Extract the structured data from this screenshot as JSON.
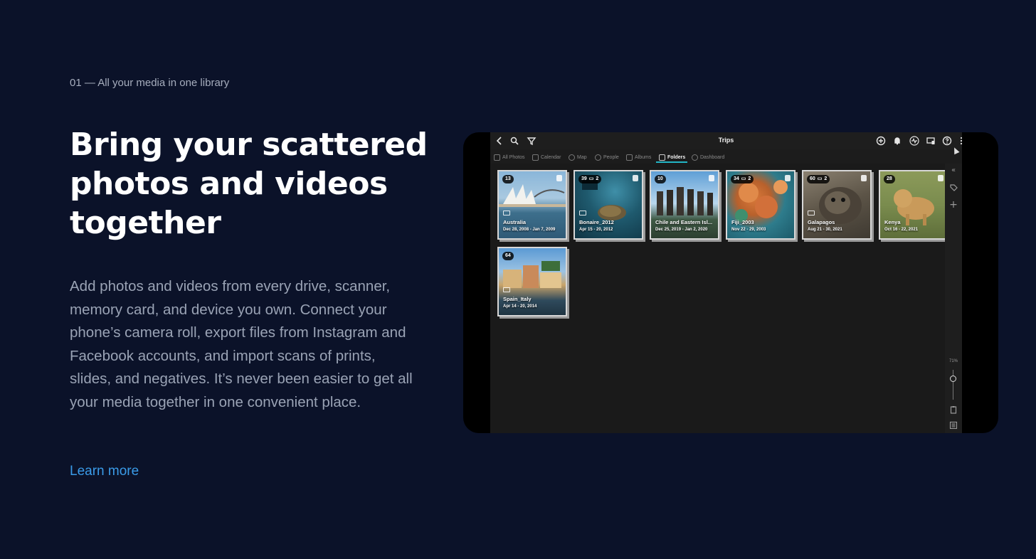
{
  "section": {
    "eyebrow": "01 — All your media in one library",
    "headline": "Bring your scattered photos and videos together",
    "body": "Add photos and videos from every drive, scanner, memory card, and device you own. Connect your phone’s camera roll, export files from Instagram and Facebook accounts, and import scans of prints, slides, and negatives. It’s never been easier to get all your media together in one convenient place.",
    "learn_more": "Learn more"
  },
  "app": {
    "title": "Trips",
    "toolbar_icons": [
      "back-icon",
      "search-icon",
      "filter-icon",
      "add-icon",
      "bell-icon",
      "activity-icon",
      "devices-icon",
      "help-icon",
      "more-icon"
    ],
    "tabs": [
      {
        "label": "All Photos",
        "icon": "grid-icon",
        "active": false
      },
      {
        "label": "Calendar",
        "icon": "calendar-icon",
        "active": false
      },
      {
        "label": "Map",
        "icon": "map-pin-icon",
        "active": false
      },
      {
        "label": "People",
        "icon": "people-icon",
        "active": false
      },
      {
        "label": "Albums",
        "icon": "album-icon",
        "active": false
      },
      {
        "label": "Folders",
        "icon": "folder-icon",
        "active": true
      },
      {
        "label": "Dashboard",
        "icon": "dashboard-icon",
        "active": false
      }
    ],
    "zoom_level": "71%",
    "zoom_fraction": 0.71,
    "colors": {
      "accent": "#22b5c6",
      "link": "#3a9be8",
      "background": "#0b1229"
    },
    "folders": [
      {
        "name": "Australia",
        "dates": "Dec 28, 2008 - Jan 7, 2009",
        "count": "13",
        "subfolders": ""
      },
      {
        "name": "Bonaire_2012",
        "dates": "Apr 15 - 20, 2012",
        "count": "39",
        "subfolders": "2"
      },
      {
        "name": "Chile and Eastern Isl...",
        "dates": "Dec 25, 2019 - Jan 2, 2020",
        "count": "10",
        "subfolders": ""
      },
      {
        "name": "Fiji_2003",
        "dates": "Nov 22 - 29, 2003",
        "count": "34",
        "subfolders": "2"
      },
      {
        "name": "Galapagos",
        "dates": "Aug 21 - 30, 2021",
        "count": "60",
        "subfolders": "2"
      },
      {
        "name": "Kenya",
        "dates": "Oct 16 - 22, 2021",
        "count": "28",
        "subfolders": ""
      },
      {
        "name": "Spain_Italy",
        "dates": "Apr 14 - 20, 2014",
        "count": "64",
        "subfolders": ""
      }
    ]
  }
}
